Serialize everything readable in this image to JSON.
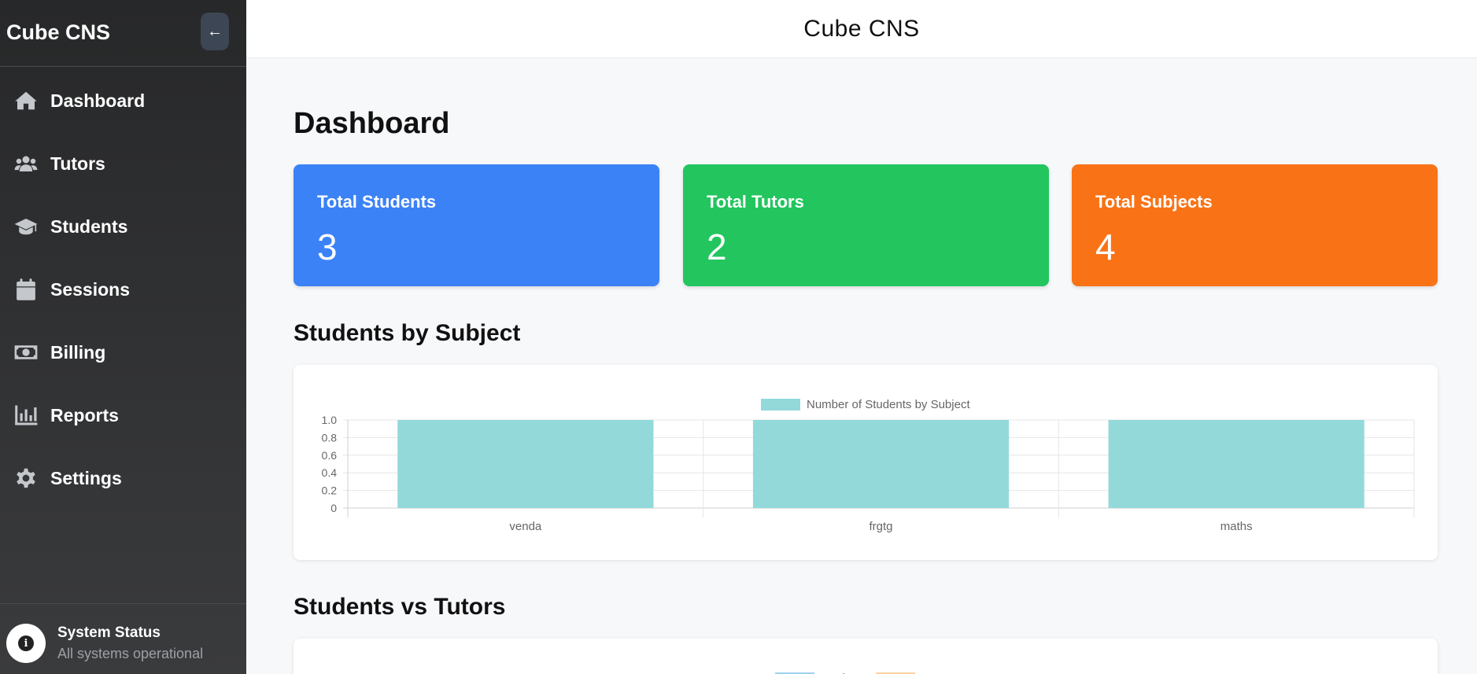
{
  "app": {
    "brand": "Cube CNS",
    "top_title": "Cube CNS",
    "collapse_label": "←"
  },
  "sidebar": {
    "items": [
      {
        "label": "Dashboard",
        "icon": "home-icon"
      },
      {
        "label": "Tutors",
        "icon": "users-icon"
      },
      {
        "label": "Students",
        "icon": "graduation-cap-icon"
      },
      {
        "label": "Sessions",
        "icon": "calendar-icon"
      },
      {
        "label": "Billing",
        "icon": "money-icon"
      },
      {
        "label": "Reports",
        "icon": "bar-chart-icon"
      },
      {
        "label": "Settings",
        "icon": "gear-icon"
      }
    ],
    "status": {
      "icon": "info-icon",
      "glyph": "i",
      "title": "System Status",
      "subtitle": "All systems operational"
    }
  },
  "main": {
    "title": "Dashboard",
    "cards": [
      {
        "label": "Total Students",
        "value": "3",
        "color": "#3b82f6"
      },
      {
        "label": "Total Tutors",
        "value": "2",
        "color": "#22c55e"
      },
      {
        "label": "Total Subjects",
        "value": "4",
        "color": "#f97316"
      }
    ],
    "sections": {
      "subject_chart_title": "Students by Subject",
      "comparison_title": "Students vs Tutors"
    }
  },
  "chart_data": [
    {
      "type": "bar",
      "title": "",
      "categories": [
        "venda",
        "frgtg",
        "maths"
      ],
      "series": [
        {
          "name": "Number of Students by Subject",
          "values": [
            1,
            1,
            1
          ],
          "color": "#93d9da"
        }
      ],
      "ylim": [
        0,
        1.0
      ],
      "yticks": [
        "1.0",
        "0.8",
        "0.6",
        "0.4",
        "0.2",
        "0"
      ],
      "grid": true,
      "legend": "top-center"
    },
    {
      "type": "bar",
      "title": "",
      "series": [
        {
          "name": "Students",
          "color": "#9fd3ef"
        },
        {
          "name": "Tutors",
          "color": "#fcd3a6"
        }
      ],
      "legend": "top-center"
    }
  ]
}
